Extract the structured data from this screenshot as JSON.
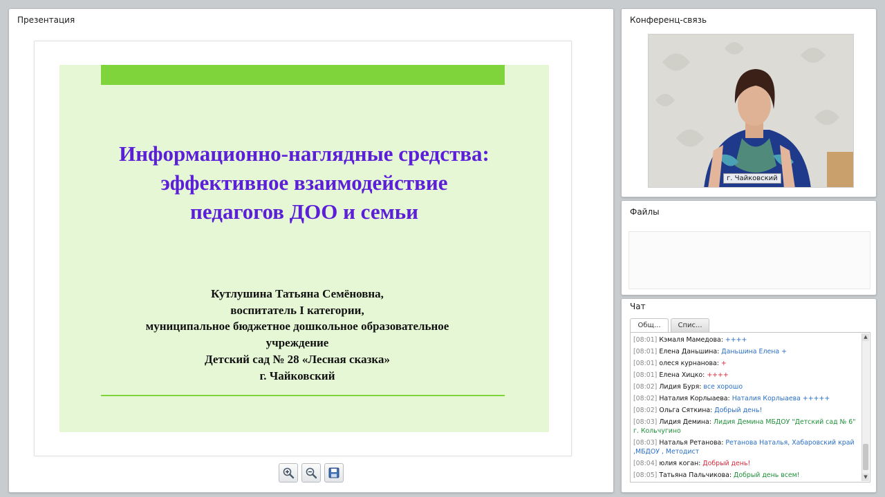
{
  "presentation": {
    "title": "Презентация",
    "slide": {
      "title_lines": [
        "Информационно-наглядные средства:",
        "эффективное взаимодействие",
        "педагогов ДОО и семьи"
      ],
      "author_lines": [
        "Кутлушина Татьяна Семёновна,",
        "воспитатель I категории,",
        "муниципальное бюджетное дошкольное образовательное",
        "учреждение",
        "Детский сад № 28 «Лесная сказка»",
        "г. Чайковский"
      ],
      "colors": {
        "background": "#e6f7d6",
        "accent_bar": "#7ed43a",
        "title_text": "#5a1fd6"
      }
    },
    "toolbar": {
      "zoom_in_icon": "zoom-in-icon",
      "zoom_out_icon": "zoom-out-icon",
      "save_icon": "save-icon"
    }
  },
  "conference": {
    "title": "Конференц-связь",
    "video_label": "г. Чайковский"
  },
  "files": {
    "title": "Файлы"
  },
  "chat": {
    "title": "Чат",
    "tabs": [
      "Общ...",
      "Спис..."
    ],
    "messages": [
      {
        "time": "[08:01]",
        "name": "Кэмаля Мамедова:",
        "text": "++++",
        "color": "#2a6fc4"
      },
      {
        "time": "[08:01]",
        "name": "Елена Даньшина:",
        "text": "Даньшина Елена +",
        "color": "#2a6fc4"
      },
      {
        "time": "[08:01]",
        "name": "олеся курнанова:",
        "text": "+",
        "color": "#d9283a"
      },
      {
        "time": "[08:01]",
        "name": "Елена Хицко:",
        "text": "++++",
        "color": "#d9283a"
      },
      {
        "time": "[08:02]",
        "name": "Лидия Буря:",
        "text": "все хорошо",
        "color": "#2a6fc4"
      },
      {
        "time": "[08:02]",
        "name": "Наталия Корлыаева:",
        "text": "Наталия Корлыаева +++++",
        "color": "#2a6fc4"
      },
      {
        "time": "[08:02]",
        "name": "Ольга Сяткина:",
        "text": "Добрый день!",
        "color": "#2a6fc4"
      },
      {
        "time": "[08:03]",
        "name": "Лидия Демина:",
        "text": "Лидия Демина МБДОУ \"Детский сад № 6\" г. Кольчугино",
        "color": "#1f8f3a"
      },
      {
        "time": "[08:03]",
        "name": "Наталья Ретанова:",
        "text": "Ретанова Наталья, Хабаровский край ,МБДОУ , Методист",
        "color": "#2a6fc4"
      },
      {
        "time": "[08:04]",
        "name": "юлия коган:",
        "text": "Добрый день!",
        "color": "#d9283a"
      },
      {
        "time": "[08:05]",
        "name": "Татьяна Пальчикова:",
        "text": "Добрый день всем!",
        "color": "#1f8f3a"
      }
    ]
  }
}
